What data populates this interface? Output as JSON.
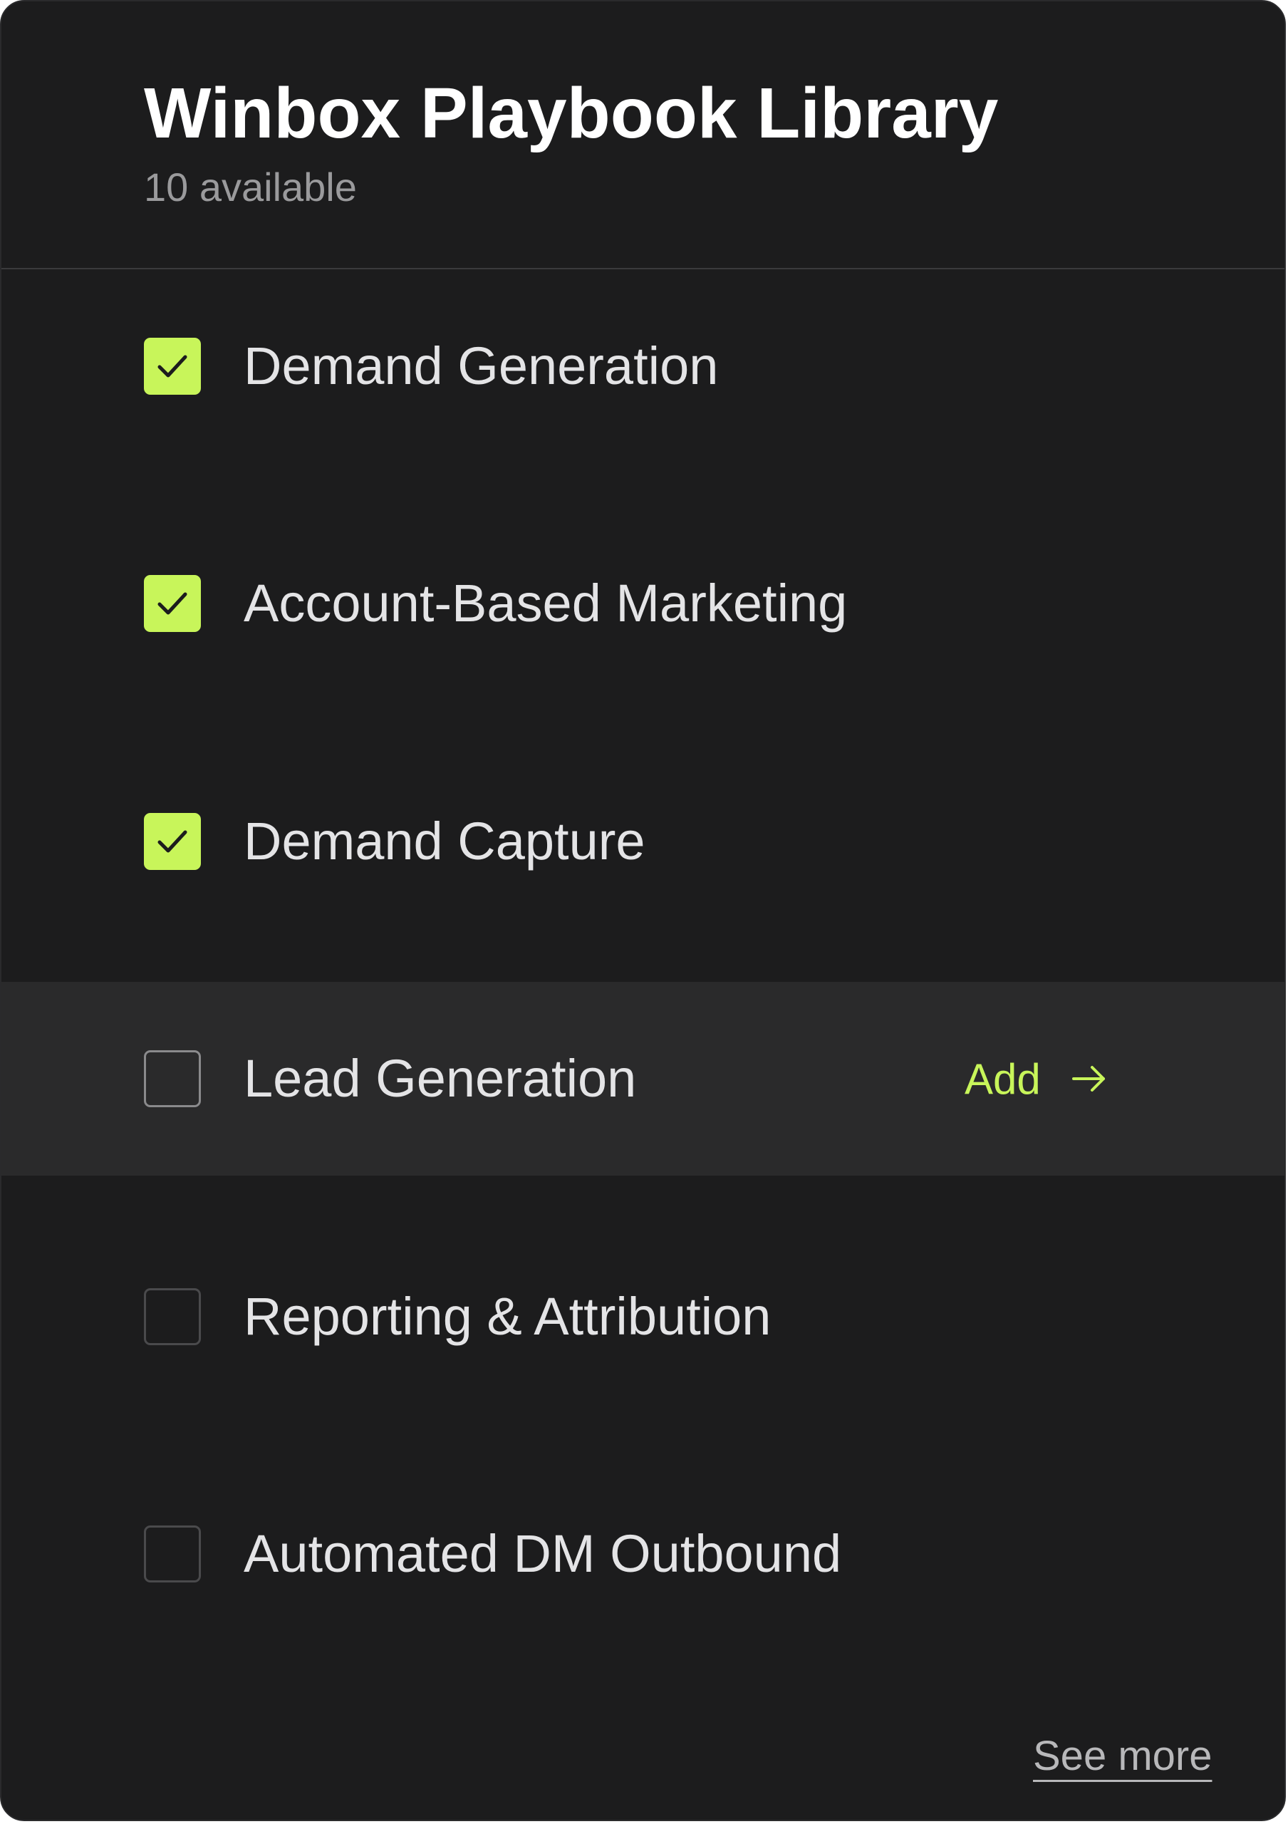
{
  "header": {
    "title": "Winbox Playbook Library",
    "subtitle": "10 available"
  },
  "playbooks": [
    {
      "label": "Demand Generation",
      "checked": true
    },
    {
      "label": "Account-Based Marketing",
      "checked": true
    },
    {
      "label": "Demand Capture",
      "checked": true
    },
    {
      "label": "Lead Generation",
      "checked": false,
      "hovered": true,
      "action_label": "Add",
      "action_icon": "arrow-right-icon"
    },
    {
      "label": "Reporting & Attribution",
      "checked": false
    },
    {
      "label": "Automated DM Outbound",
      "checked": false
    }
  ],
  "footer": {
    "see_more_label": "See more"
  },
  "colors": {
    "accent": "#c8f55a",
    "background": "#1c1c1d",
    "hover_row": "#2a2a2b",
    "text": "#e4e4e6",
    "muted_text": "#9a9a9c"
  }
}
